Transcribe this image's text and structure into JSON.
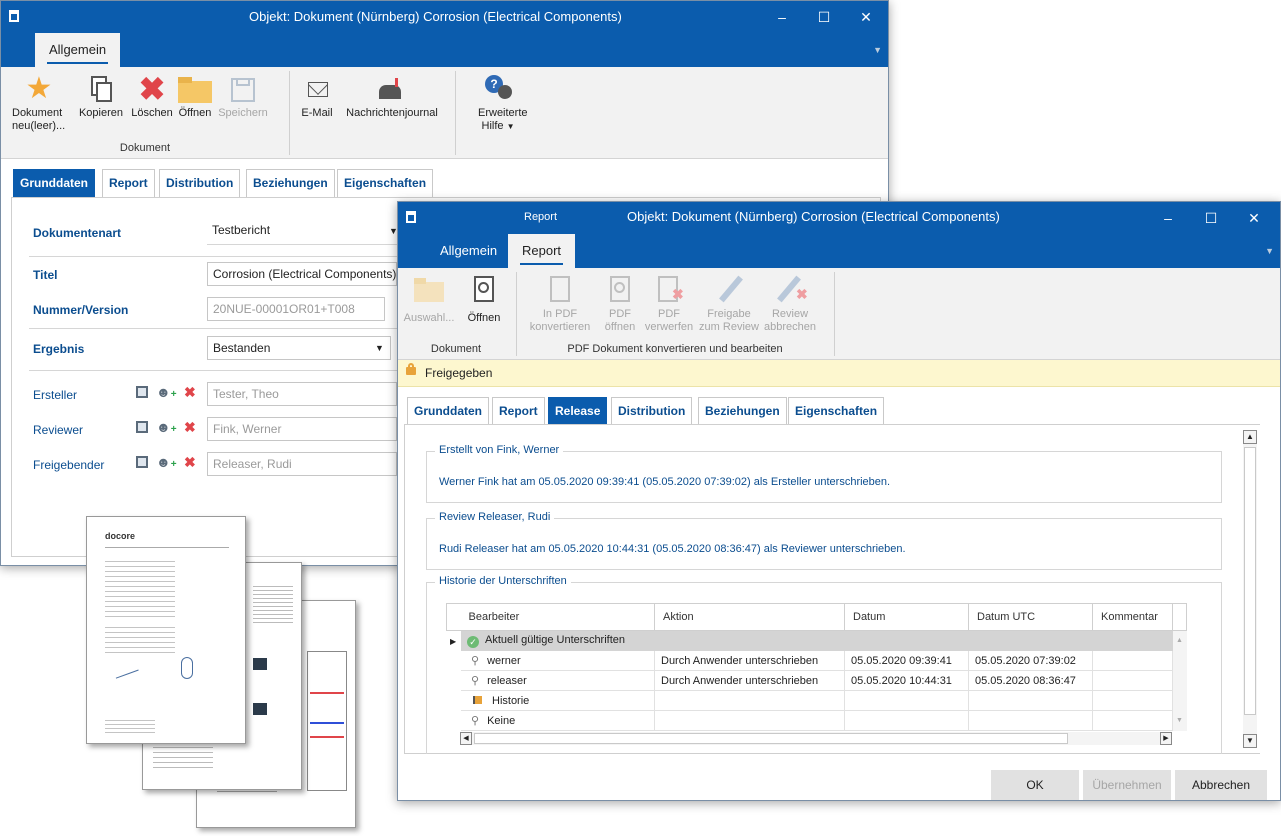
{
  "back_window": {
    "title": "Objekt: Dokument (Nürnberg) Corrosion (Electrical Components)",
    "ribbon_tab": "Allgemein",
    "ribbon": {
      "new_doc": "Dokument neu(leer)...",
      "copy": "Kopieren",
      "delete": "Löschen",
      "open": "Öffnen",
      "save": "Speichern",
      "group_document": "Dokument",
      "email": "E-Mail",
      "journal": "Nachrichtenjournal",
      "help": "Erweiterte Hilfe"
    },
    "tabs": [
      "Grunddaten",
      "Report",
      "Distribution",
      "Beziehungen",
      "Eigenschaften"
    ],
    "fields": {
      "doctype_label": "Dokumentenart",
      "doctype_value": "Testbericht",
      "title_label": "Titel",
      "title_value": "Corrosion (Electrical Components)",
      "number_label": "Nummer/Version",
      "number_value": "20NUE-00001OR01+T008",
      "result_label": "Ergebnis",
      "result_value": "Bestanden",
      "creator_label": "Ersteller",
      "creator_value": "Tester, Theo",
      "reviewer_label": "Reviewer",
      "reviewer_value": "Fink, Werner",
      "releaser_label": "Freigebender",
      "releaser_value": "Releaser, Rudi"
    }
  },
  "front_window": {
    "title_left": "Report",
    "title": "Objekt: Dokument (Nürnberg) Corrosion (Electrical Components)",
    "ribbon_tabs": [
      "Allgemein",
      "Report"
    ],
    "ribbon": {
      "select": "Auswahl...",
      "open": "Öffnen",
      "group_document": "Dokument",
      "to_pdf": "In PDF konvertieren",
      "pdf_open": "PDF öffnen",
      "pdf_discard": "PDF verwerfen",
      "release_review": "Freigabe zum Review",
      "cancel_review": "Review abbrechen",
      "group_pdf": "PDF Dokument konvertieren und bearbeiten"
    },
    "status": "Freigegeben",
    "tabs": [
      "Grunddaten",
      "Report",
      "Release",
      "Distribution",
      "Beziehungen",
      "Eigenschaften"
    ],
    "created_by": {
      "legend": "Erstellt von Fink, Werner",
      "message": "Werner Fink hat am 05.05.2020 09:39:41 (05.05.2020 07:39:02) als Ersteller unterschrieben."
    },
    "review": {
      "legend": "Review Releaser, Rudi",
      "message": "Rudi Releaser hat am 05.05.2020 10:44:31 (05.05.2020 08:36:47) als Reviewer unterschrieben."
    },
    "history": {
      "legend": "Historie der Unterschriften",
      "columns": [
        "Bearbeiter",
        "Aktion",
        "Datum",
        "Datum UTC",
        "Kommentar"
      ],
      "group": "Aktuell gültige Unterschriften",
      "rows": [
        {
          "user": "werner",
          "action": "Durch Anwender unterschrieben",
          "date": "05.05.2020 09:39:41",
          "utc": "05.05.2020 07:39:02",
          "comment": ""
        },
        {
          "user": "releaser",
          "action": "Durch Anwender unterschrieben",
          "date": "05.05.2020 10:44:31",
          "utc": "05.05.2020 08:36:47",
          "comment": ""
        }
      ],
      "history_row": "Historie",
      "none_row": "Keine"
    },
    "buttons": {
      "ok": "OK",
      "apply": "Übernehmen",
      "cancel": "Abbrechen"
    }
  },
  "doc_preview": {
    "logo": "docore"
  }
}
